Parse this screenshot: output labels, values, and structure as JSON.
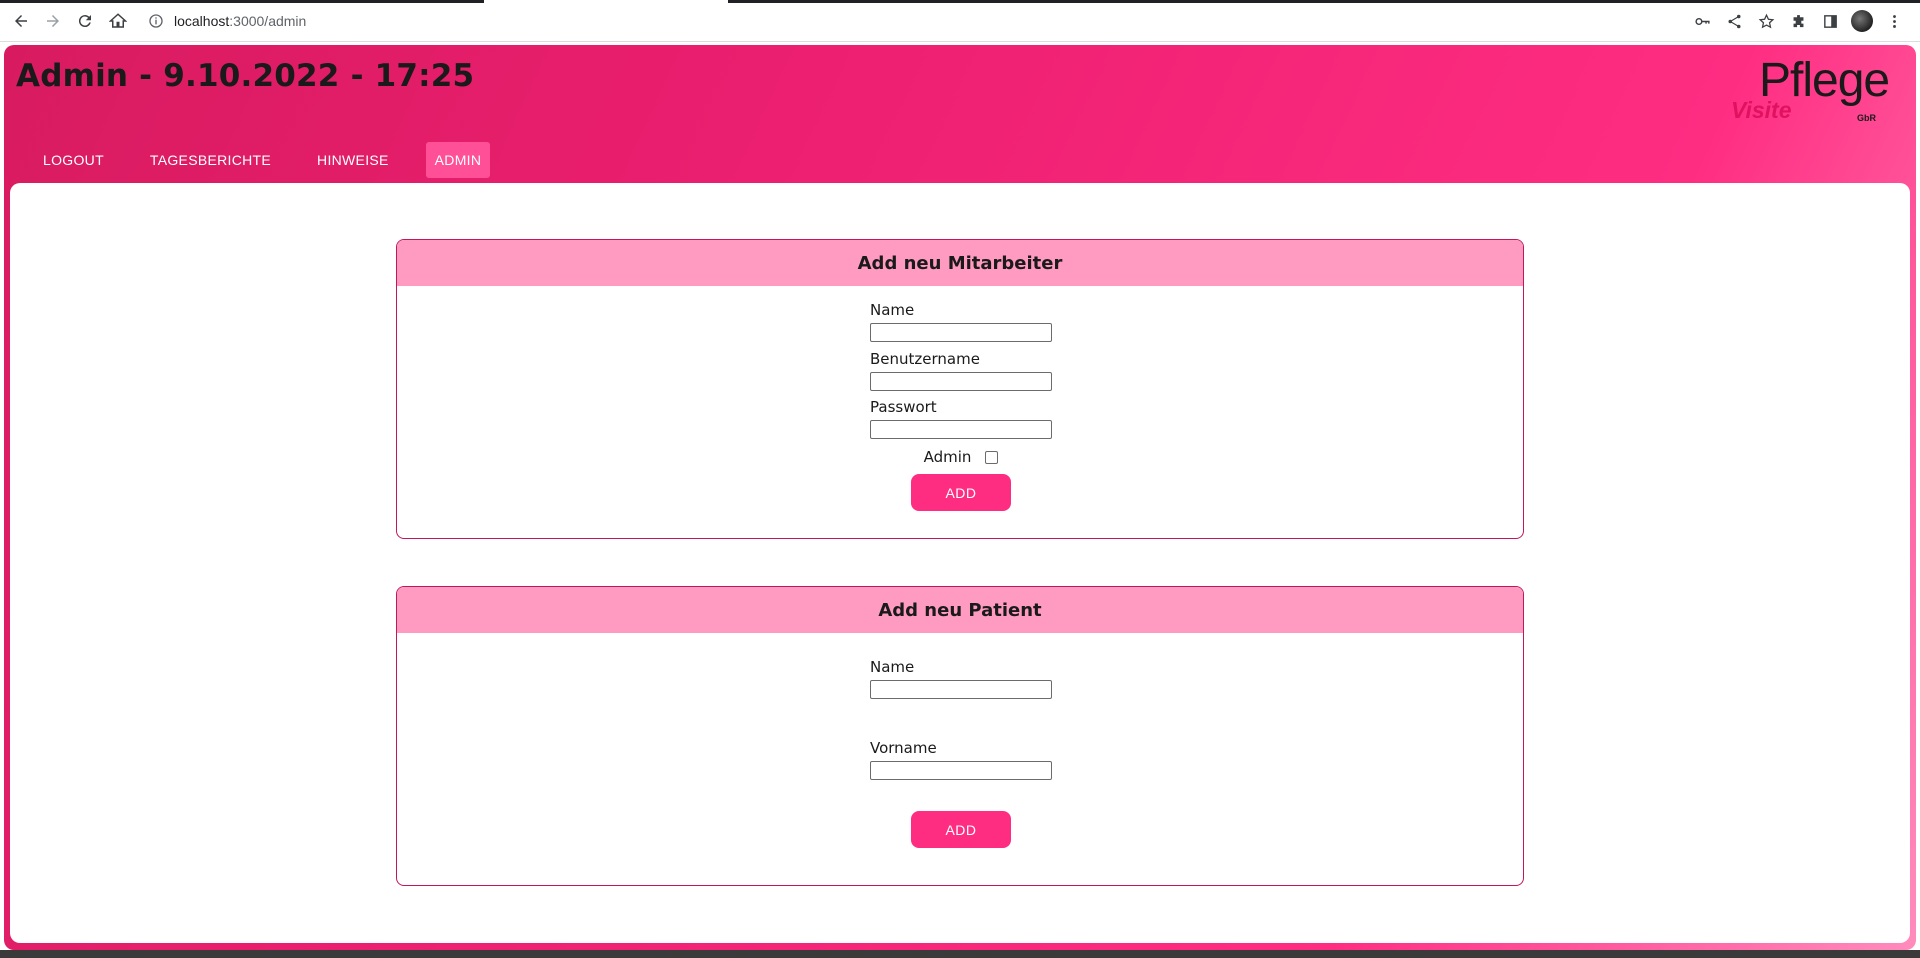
{
  "browser": {
    "url_host": "localhost",
    "url_path": ":3000/admin"
  },
  "header": {
    "title": "Admin - 9.10.2022 - 17:25",
    "logo": {
      "line1": "Pflege",
      "line2": "Visite",
      "suffix": "GbR"
    }
  },
  "nav": {
    "items": [
      {
        "label": "LOGOUT"
      },
      {
        "label": "TAGESBERICHTE"
      },
      {
        "label": "HINWEISE"
      },
      {
        "label": "ADMIN",
        "active": true
      }
    ]
  },
  "employee_form": {
    "heading": "Add neu Mitarbeiter",
    "name_label": "Name",
    "name_value": "",
    "username_label": "Benutzername",
    "username_value": "",
    "password_label": "Passwort",
    "password_value": "",
    "admin_label": "Admin",
    "admin_checked": false,
    "submit_label": "ADD"
  },
  "patient_form": {
    "heading": "Add neu Patient",
    "name_label": "Name",
    "name_value": "",
    "firstname_label": "Vorname",
    "firstname_value": "",
    "submit_label": "ADD"
  },
  "colors": {
    "brand_primary": "#ff2d82",
    "brand_dark": "#d81b60",
    "card_header": "#ff9ac1",
    "card_border": "#c2185b"
  }
}
